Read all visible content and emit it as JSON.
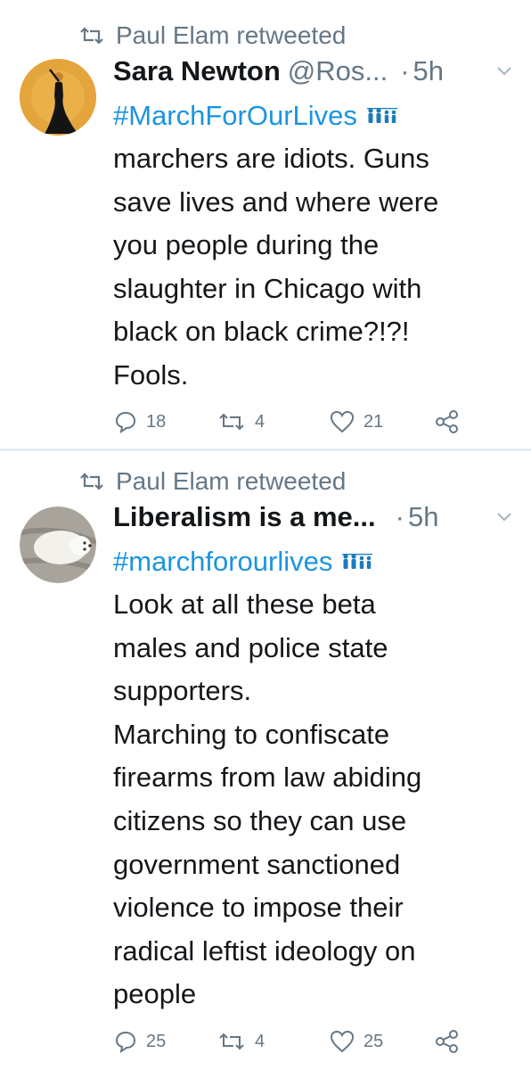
{
  "tweets": [
    {
      "retweeted_by": "Paul Elam retweeted",
      "name": "Sara Newton",
      "handle": "@Ros...",
      "dot": "·",
      "time": "5h",
      "hashtag": "#MarchForOurLives",
      "text": "marchers are idiots. Guns\nsave lives and where were\nyou people during the\nslaughter in Chicago with\nblack on black crime?!?!\nFools.",
      "replies": "18",
      "retweets": "4",
      "likes": "21",
      "avatar_icon": "woman-in-black-dress-avatar"
    },
    {
      "retweeted_by": "Paul Elam retweeted",
      "name": "Liberalism is a me...",
      "handle": "",
      "dot": "·",
      "time": "5h",
      "hashtag": "#marchforourlives",
      "text": "Look at all these beta\nmales and police state\nsupporters.\nMarching to confiscate\nfirearms from law abiding\ncitizens so they can use\ngovernment sanctioned\nviolence to impose their\nradical leftist ideology on\npeople",
      "replies": "25",
      "retweets": "4",
      "likes": "25",
      "avatar_icon": "white-dog-avatar"
    }
  ],
  "colors": {
    "link": "#1b95e0",
    "secondary": "#657786",
    "primary": "#14171a",
    "divider": "#e6ecf0"
  },
  "icons": [
    "retweet-icon",
    "caret-down-icon",
    "reply-icon",
    "like-icon",
    "share-icon",
    "family-emoji-icon"
  ]
}
